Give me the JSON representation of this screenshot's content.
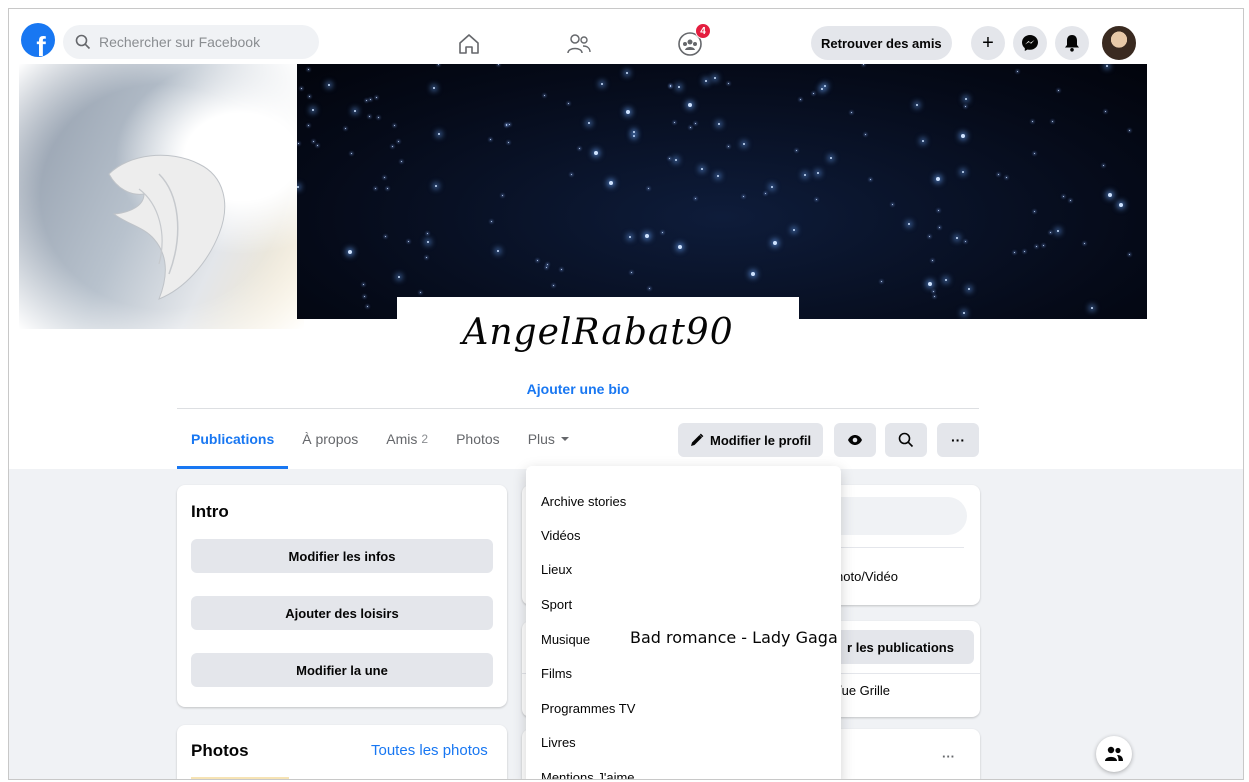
{
  "topbar": {
    "logo": "f",
    "search_placeholder": "Rechercher sur Facebook",
    "groups_badge": "4",
    "find_friends": "Retrouver des amis",
    "plus_label": "+"
  },
  "profile": {
    "name": "AngelRabat90",
    "add_bio": "Ajouter une bio"
  },
  "tabs": {
    "publications": "Publications",
    "about": "À propos",
    "friends": "Amis",
    "friends_count": "2",
    "photos": "Photos",
    "more": "Plus"
  },
  "actions": {
    "edit_profile": "Modifier le profil",
    "more_dots": "···"
  },
  "intro": {
    "title": "Intro",
    "edit_info": "Modifier les infos",
    "add_hobbies": "Ajouter des loisirs",
    "edit_featured": "Modifier la une"
  },
  "photos_card": {
    "title": "Photos",
    "all_photos": "Toutes les photos"
  },
  "dropdown": {
    "items": [
      "Archive stories",
      "Vidéos",
      "Lieux",
      "Sport",
      "Musique",
      "Films",
      "Programmes TV",
      "Livres",
      "Mentions J'aime"
    ],
    "music_now": "Bad romance - Lady Gaga"
  },
  "right_column": {
    "photo_video": "hoto/Vidéo",
    "manage_posts": "r les publications",
    "grid_view": "/ue Grille",
    "dots": "···"
  },
  "colors": {
    "brand": "#1877f2",
    "badge": "#e41e3f",
    "button_grey": "#e4e6eb",
    "page_bg": "#f0f2f5"
  }
}
